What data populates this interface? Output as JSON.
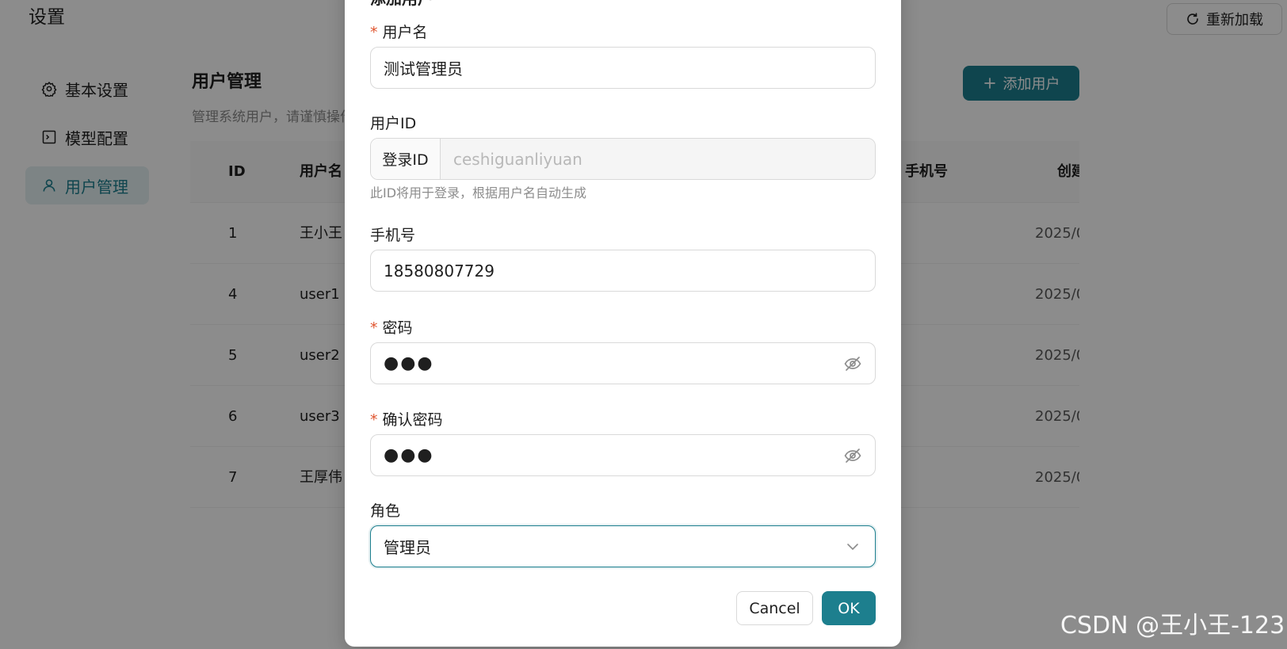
{
  "page": {
    "title": "设置",
    "reload_label": "重新加载"
  },
  "sidebar": {
    "items": [
      {
        "label": "基本设置",
        "icon": "gear-icon"
      },
      {
        "label": "模型配置",
        "icon": "terminal-icon"
      },
      {
        "label": "用户管理",
        "icon": "user-icon",
        "active": true
      }
    ]
  },
  "users": {
    "title": "用户管理",
    "description": "管理系统用户，请谨慎操作",
    "add_label": "添加用户",
    "columns": {
      "id": "ID",
      "name": "用户名",
      "phone": "手机号",
      "created": "创建时间"
    },
    "rows": [
      {
        "id": "1",
        "name": "王小王",
        "created": "2025/0"
      },
      {
        "id": "4",
        "name": "user1",
        "created": "2025/0"
      },
      {
        "id": "5",
        "name": "user2",
        "created": "2025/0"
      },
      {
        "id": "6",
        "name": "user3",
        "created": "2025/0"
      },
      {
        "id": "7",
        "name": "王厚伟",
        "created": "2025/0"
      }
    ]
  },
  "modal": {
    "title": "添加用户",
    "username": {
      "label": "用户名",
      "required": true,
      "value": "测试管理员"
    },
    "user_id": {
      "label": "用户ID",
      "addon": "登录ID",
      "value": "ceshiguanliyuan",
      "help": "此ID将用于登录，根据用户名自动生成"
    },
    "phone": {
      "label": "手机号",
      "value": "18580807729"
    },
    "password": {
      "label": "密码",
      "required": true,
      "masked_value": "●●●"
    },
    "confirm_password": {
      "label": "确认密码",
      "required": true,
      "masked_value": "●●●"
    },
    "role": {
      "label": "角色",
      "value": "管理员"
    },
    "cancel_label": "Cancel",
    "ok_label": "OK"
  },
  "watermark": "CSDN @王小王-123",
  "colors": {
    "primary": "#1d7f8e",
    "required": "#e0552f",
    "mask": "rgba(0,0,0,0.45)"
  }
}
